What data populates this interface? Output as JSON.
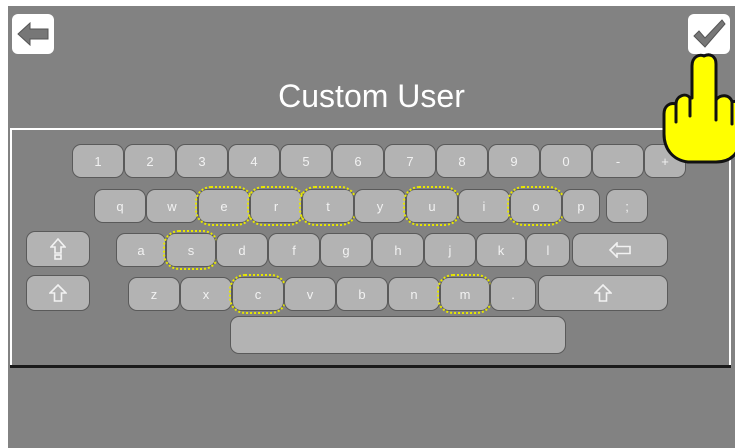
{
  "header": {
    "title": "Custom User",
    "back_icon": "arrow-left-icon",
    "confirm_icon": "checkmark-icon"
  },
  "keyboard": {
    "number_row": [
      "1",
      "2",
      "3",
      "4",
      "5",
      "6",
      "7",
      "8",
      "9",
      "0",
      "-",
      "+"
    ],
    "row_q": [
      "q",
      "w",
      "e",
      "r",
      "t",
      "y",
      "u",
      "i",
      "o",
      "p",
      ";"
    ],
    "row_a": [
      "a",
      "s",
      "d",
      "f",
      "g",
      "h",
      "j",
      "k",
      "l"
    ],
    "row_z": [
      "z",
      "x",
      "c",
      "v",
      "b",
      "n",
      "m",
      "."
    ],
    "icons": {
      "caps_lock": "caps-lock-icon",
      "backspace": "backspace-icon",
      "shift": "shift-icon"
    },
    "highlighted_keys": [
      "e",
      "r",
      "t",
      "u",
      "o",
      "s",
      "c",
      "m"
    ]
  },
  "colors": {
    "background": "#828282",
    "key": "#b3b3b3",
    "highlight": "#e8e800",
    "hand": "#ffff00"
  },
  "pointer_icon": "pointing-hand-icon"
}
